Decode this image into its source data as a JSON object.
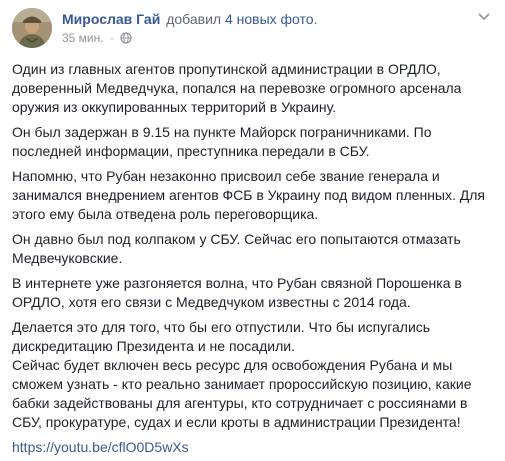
{
  "post": {
    "author": "Мирослав Гай",
    "action_prefix": "добавил",
    "action_link": "4 новых фото",
    "action_suffix": ".",
    "timestamp": "35 мин.",
    "privacy_icon": "globe-icon",
    "options_icon": "chevron-down-icon",
    "paragraphs": [
      "Один из главных агентов пропутинской администрации в ОРДЛО, доверенный Медведчука, попался на перевозке огромного арсенала оружия из оккупированных территорий в Украину.",
      "Он был задержан в 9.15 на пункте Майорск пограничниками. По последней информации, преступника передали в СБУ.",
      "Напомню, что Рубан незаконно присвоил себе звание генерала и занимался внедрением агентов ФСБ в Украину под видом пленных. Для этого ему была отведена роль переговорщика.",
      "Он давно был под колпаком у СБУ. Сейчас его попытаются отмазать Медвечуковские.",
      "В интернете уже разгоняется волна, что Рубан связной Порошенка в ОРДЛО, хотя его связи с Медведчуком известны с 2014 года.",
      "Делается это для того, что бы его отпустили. Что бы испугались дискредитацию Президента и не посадили.",
      "Сейчас будет включен весь ресурс для освобождения Рубана и мы сможем узнать - кто реально занимает пророссийскую позицию, какие бабки задействованы для агентуры, кто сотрудничает с россиянами в СБУ, прокуратуре, судах и если кроты в администрации Президента!"
    ],
    "link": "https://youtu.be/cflO0D5wXs"
  },
  "colors": {
    "link": "#365899",
    "text": "#1d2129",
    "meta": "#90949c"
  }
}
